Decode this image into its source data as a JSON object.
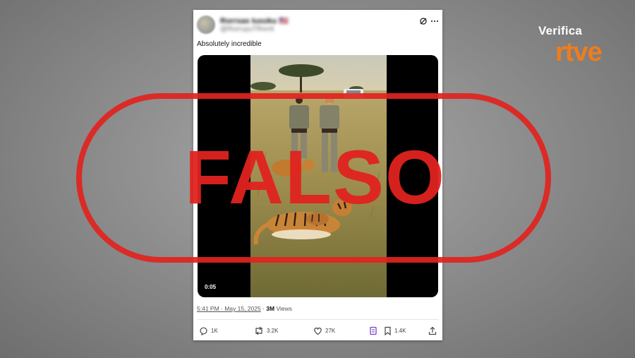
{
  "post": {
    "display_name": "Rorrxas Iuxoku 🇺🇸",
    "handle": "@RorruyuTRorrit",
    "text": "Absolutely incredible",
    "video_duration": "0:05",
    "timestamp": "5:41 PM · May 15, 2025",
    "separator": " · ",
    "views": "3M",
    "views_label": " Views"
  },
  "actions": {
    "replies": "1K",
    "reposts": "3.2K",
    "likes": "27K",
    "bookmarks": "1.4K"
  },
  "stamp": {
    "text": "FALSO",
    "color": "#e0231f"
  },
  "brand": {
    "verifica": "Verifica",
    "rtve": "rtve",
    "rtve_color": "#f07c1c"
  },
  "icons": [
    "grok-icon",
    "more-icon",
    "reply-icon",
    "repost-icon",
    "like-icon",
    "grok-analyze-icon",
    "bookmark-icon",
    "share-icon"
  ]
}
